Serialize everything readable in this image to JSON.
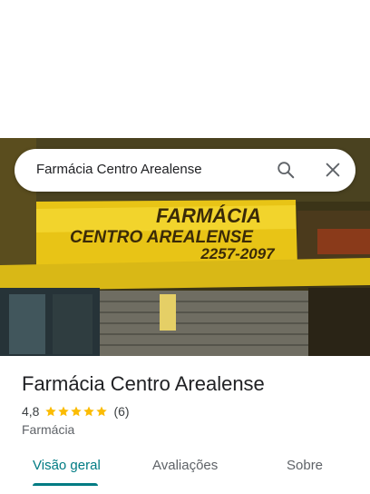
{
  "search": {
    "query": "Farmácia Centro Arealense"
  },
  "photo": {
    "sign_line1": "FARMÁCIA",
    "sign_line2": "CENTRO AREALENSE",
    "sign_phone": "2257-2097"
  },
  "place": {
    "name": "Farmácia Centro Arealense",
    "rating": "4,8",
    "stars": 5,
    "review_count": "(6)",
    "category": "Farmácia"
  },
  "tabs": [
    {
      "label": "Visão geral",
      "active": true
    },
    {
      "label": "Avaliações",
      "active": false
    },
    {
      "label": "Sobre",
      "active": false
    }
  ],
  "colors": {
    "accent": "#007b83",
    "star": "#fbbc04",
    "sign_yellow": "#f5d31a"
  },
  "icons": {
    "search": "search-icon",
    "close": "close-icon",
    "star": "star-icon"
  }
}
